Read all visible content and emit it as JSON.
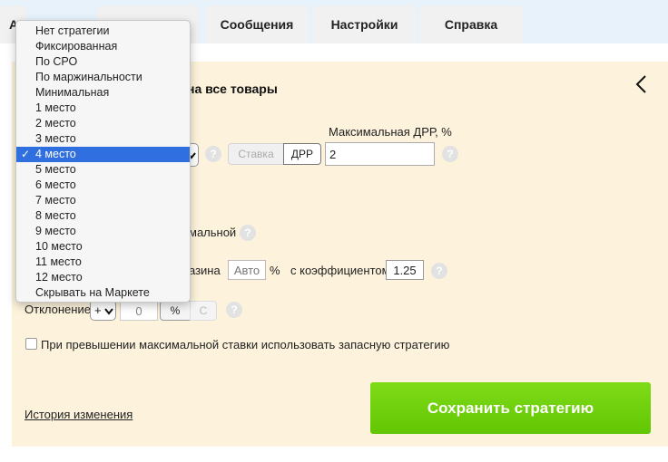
{
  "tabs": [
    {
      "label": "А"
    },
    {
      "label": "Сообщения"
    },
    {
      "label": "Настройки"
    },
    {
      "label": "Справка"
    }
  ],
  "panel": {
    "title_fragment": "на все товары",
    "max_drr_label": "Максимальная ДРР, %",
    "bid_toggle": {
      "off_label": "Ставка",
      "on_label": "ДРР"
    },
    "max_drr_value": "2",
    "fragment_minimal": "мальной",
    "fragment_store": "азина",
    "auto_placeholder": "Авто",
    "percent_sign": "%",
    "coef_label": "с коэффициентом",
    "coef_value": "1.25",
    "deviation_label": "Отклонение",
    "deviation_sign": "+",
    "deviation_value": "0",
    "unit_percent": "%",
    "unit_c": "С",
    "fallback_label": "При превышении максимальной ставки использовать запасную стратегию",
    "history_link": "История изменения",
    "save_button": "Сохранить стратегию"
  },
  "help_glyph": "?",
  "dropdown": {
    "selected_index": 8,
    "check_glyph": "✓",
    "options": [
      "Нет стратегии",
      "Фиксированная",
      "По СРО",
      "По маржинальности",
      "Минимальная",
      "1 место",
      "2 место",
      "3 место",
      "4 место",
      "5 место",
      "6 место",
      "7 место",
      "8 место",
      "9 место",
      "10 место",
      "11 место",
      "12 место",
      "Скрывать на Маркете"
    ]
  },
  "colors": {
    "panel_bg": "#fdf3dc",
    "topbar_bg": "#e7f2fb",
    "save_green": "#6ccf08",
    "selection_blue": "#2f6fe0"
  }
}
